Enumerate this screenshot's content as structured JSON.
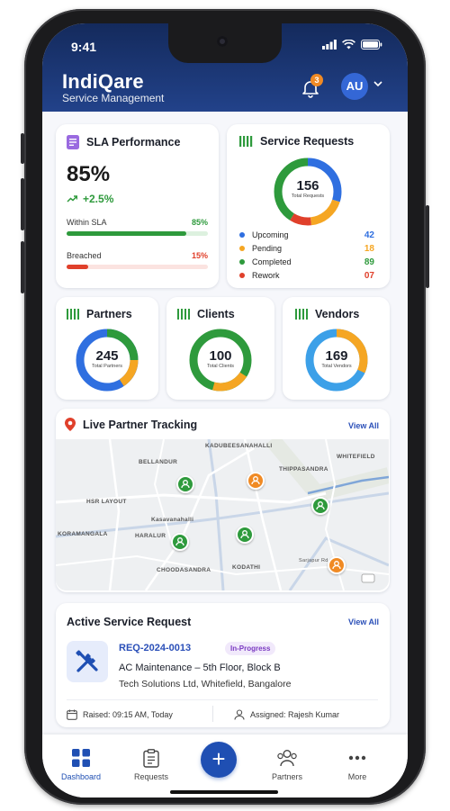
{
  "status_bar": {
    "time": "9:41"
  },
  "header": {
    "brand": "IndiQare",
    "subtitle": "Service Management",
    "notification_count": "3",
    "avatar_initials": "AU"
  },
  "sla": {
    "title": "SLA Performance",
    "value": "85%",
    "change": "+2.5%",
    "within_label": "Within SLA",
    "within_value": "85%",
    "within_fraction": 0.85,
    "breached_label": "Breached",
    "breached_value": "15%",
    "breached_fraction": 0.15
  },
  "service_requests": {
    "title": "Service Requests",
    "total": "156",
    "total_label": "Total Requests",
    "items": [
      {
        "label": "Upcoming",
        "value": "42",
        "color": "#2f6fe0"
      },
      {
        "label": "Pending",
        "value": "18",
        "color": "#f5a623"
      },
      {
        "label": "Completed",
        "value": "89",
        "color": "#2e9a3c"
      },
      {
        "label": "Rework",
        "value": "07",
        "color": "#e0402b"
      }
    ]
  },
  "partners": {
    "title": "Partners",
    "total": "245",
    "total_label": "Total Partners"
  },
  "clients": {
    "title": "Clients",
    "total": "100",
    "total_label": "Total Clients"
  },
  "vendors": {
    "title": "Vendors",
    "total": "169",
    "total_label": "Total Vendors"
  },
  "tracking": {
    "title": "Live Partner Tracking",
    "view_all": "View All",
    "map_labels": [
      "KADUBEESANAHALLI",
      "BELLANDUR",
      "THIPPASANDRA",
      "WHITEFIELD",
      "HSR LAYOUT",
      "Kasavanahalli",
      "KORAMANGALA",
      "HARALUR",
      "CHOODASANDRA",
      "KODATHI",
      "Sarjapur Rd"
    ]
  },
  "active_request": {
    "title": "Active Service Request",
    "view_all": "View All",
    "id": "REQ-2024-0013",
    "status": "In-Progress",
    "name": "AC Maintenance – 5th Floor, Block B",
    "company": "Tech Solutions Ltd, Whitefield, Bangalore",
    "raised": "Raised: 09:15 AM, Today",
    "assigned": "Assigned: Rajesh Kumar"
  },
  "nav": {
    "dashboard": "Dashboard",
    "requests": "Requests",
    "partners": "Partners",
    "more": "More"
  },
  "colors": {
    "primary": "#1f4fb3",
    "header": "#142a5c",
    "green": "#2e9a3c",
    "orange": "#f5a623",
    "red": "#e0402b",
    "blue": "#2f6fe0"
  }
}
